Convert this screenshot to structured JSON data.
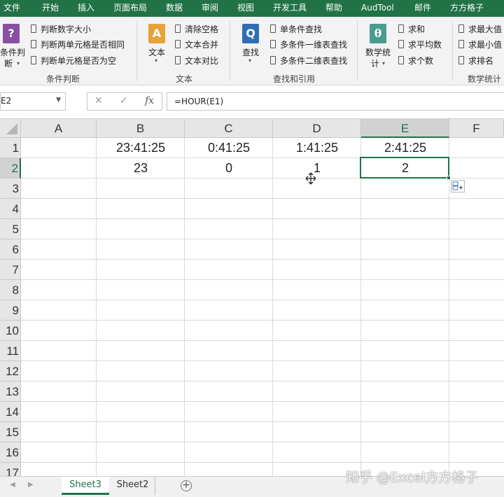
{
  "ribbon_tabs": [
    "文件",
    "开始",
    "插入",
    "页面布局",
    "数据",
    "审阅",
    "视图",
    "开发工具",
    "帮助",
    "AudTool",
    "邮件",
    "方方格子"
  ],
  "ribbon": {
    "group1": {
      "big_button": "条件判断",
      "big_button_line1": "条件判",
      "big_button_line2": "断",
      "items": [
        "判断数字大小",
        "判断两单元格是否相同",
        "判断单元格是否为空"
      ],
      "label": "条件判断"
    },
    "group2": {
      "big_button": "文本",
      "items": [
        "清除空格",
        "文本合并",
        "文本对比"
      ],
      "label": "文本"
    },
    "group3": {
      "big_button": "查找",
      "items": [
        "单条件查找",
        "多条件一维表查找",
        "多条件二维表查找"
      ],
      "label": "查找和引用"
    },
    "group4": {
      "big_button_line1": "数学统",
      "big_button_line2": "计",
      "items": [
        "求和",
        "求平均数",
        "求个数"
      ],
      "items2": [
        "求最大值",
        "求最小值",
        "求排名"
      ],
      "label": "数学统计"
    }
  },
  "formula_bar": {
    "name_box": "E2",
    "formula": "=HOUR(E1)"
  },
  "columns": [
    "A",
    "B",
    "C",
    "D",
    "E",
    "F"
  ],
  "rows": [
    "1",
    "2",
    "3",
    "4",
    "5",
    "6",
    "7",
    "8",
    "9",
    "10",
    "11",
    "12",
    "13",
    "14",
    "15",
    "16",
    "17"
  ],
  "cells": {
    "B1": "23:41:25",
    "C1": "0:41:25",
    "D1": "1:41:25",
    "E1": "2:41:25",
    "B2": "23",
    "C2": "0",
    "D2": "1",
    "E2": "2"
  },
  "selected_cell": "E2",
  "sheets": [
    "Sheet3",
    "Sheet2"
  ],
  "active_sheet": "Sheet3",
  "watermark": "知乎 @Excel方方格子",
  "colors": {
    "accent": "#217346",
    "icon_question": "#8a4fa3",
    "icon_text": "#e8a23a",
    "icon_find": "#2f6eb3",
    "icon_math": "#4a9c8f"
  }
}
